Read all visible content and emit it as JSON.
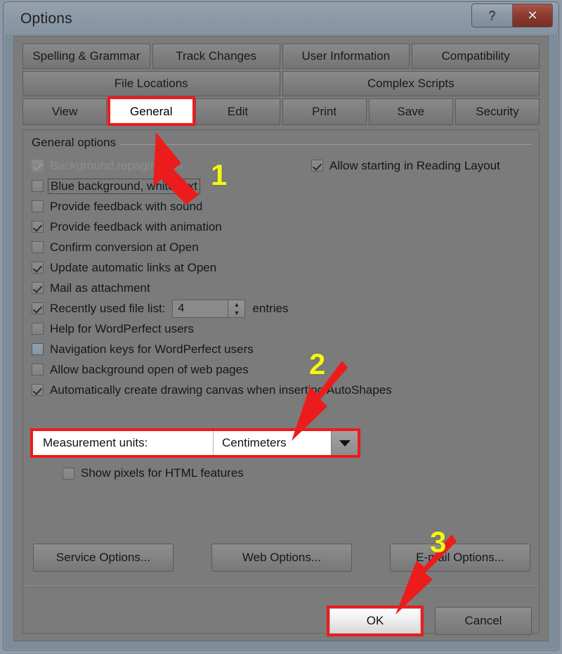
{
  "window": {
    "title": "Options",
    "buttons": [
      {
        "name": "help",
        "glyph": "?"
      },
      {
        "name": "close",
        "glyph": "✕"
      }
    ]
  },
  "tabs": {
    "row1": [
      "Spelling & Grammar",
      "Track Changes",
      "User Information",
      "Compatibility"
    ],
    "row2": [
      "File Locations",
      "Complex Scripts"
    ],
    "row3": [
      "View",
      "General",
      "Edit",
      "Print",
      "Save",
      "Security"
    ],
    "active": "General"
  },
  "general": {
    "group_label": "General options",
    "options": [
      {
        "label": "Background repagination",
        "checked": true,
        "disabled": true,
        "focus": false,
        "dotted": false
      },
      {
        "label": "Blue background, white text",
        "checked": false,
        "disabled": false,
        "focus": false,
        "dotted": true
      },
      {
        "label": "Provide feedback with sound",
        "checked": false,
        "disabled": false,
        "focus": false,
        "dotted": false
      },
      {
        "label": "Provide feedback with animation",
        "checked": true,
        "disabled": false,
        "focus": false,
        "dotted": false
      },
      {
        "label": "Confirm conversion at Open",
        "checked": false,
        "disabled": false,
        "focus": false,
        "dotted": false
      },
      {
        "label": "Update automatic links at Open",
        "checked": true,
        "disabled": false,
        "focus": false,
        "dotted": false
      },
      {
        "label": "Mail as attachment",
        "checked": true,
        "disabled": false,
        "focus": false,
        "dotted": false
      },
      {
        "label": "Recently used file list:",
        "checked": true,
        "disabled": false,
        "focus": false,
        "dotted": false,
        "spinner": true
      },
      {
        "label": "Help for WordPerfect users",
        "checked": false,
        "disabled": false,
        "focus": false,
        "dotted": false
      },
      {
        "label": "Navigation keys for WordPerfect users",
        "checked": false,
        "disabled": false,
        "focus": true,
        "dotted": false
      },
      {
        "label": "Allow background open of web pages",
        "checked": false,
        "disabled": false,
        "focus": false,
        "dotted": false
      },
      {
        "label": "Automatically create drawing canvas when inserting AutoShapes",
        "checked": true,
        "disabled": false,
        "focus": false,
        "dotted": false
      }
    ],
    "recent_files_value": "4",
    "recent_files_suffix": "entries",
    "right_option": {
      "label": "Allow starting in Reading Layout",
      "checked": true
    },
    "measurement_label": "Measurement units:",
    "measurement_value": "Centimeters",
    "show_pixels": {
      "label": "Show pixels for HTML features",
      "checked": false
    }
  },
  "buttons": {
    "service_options": "Service Options...",
    "web_options": "Web Options...",
    "email_options": "E-mail Options...",
    "ok": "OK",
    "cancel": "Cancel"
  },
  "annotations": {
    "step1": "1",
    "step2": "2",
    "step3": "3",
    "arrow_color": "#ec1c1c",
    "number_color": "#f5f515"
  }
}
